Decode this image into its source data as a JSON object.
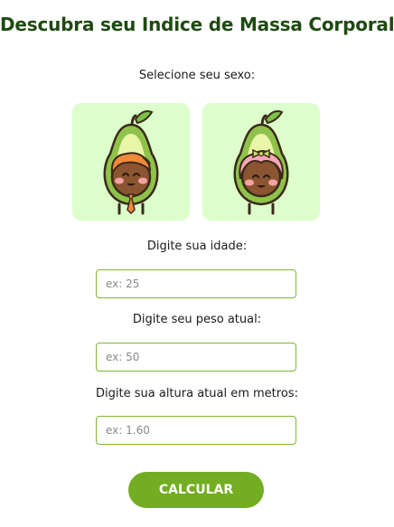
{
  "title": "Descubra seu Indice de Massa Corporal",
  "sex_selection": {
    "label": "Selecione seu sexo:",
    "options": [
      {
        "name": "male-avocado",
        "icon": "male-avocado-icon"
      },
      {
        "name": "female-avocado",
        "icon": "female-avocado-icon"
      }
    ]
  },
  "age": {
    "label": "Digite sua idade:",
    "placeholder": "ex: 25",
    "value": ""
  },
  "weight": {
    "label": "Digite seu peso atual:",
    "placeholder": "ex: 50",
    "value": ""
  },
  "height": {
    "label": "Digite sua altura atual em metros:",
    "placeholder": "ex: 1.60",
    "value": ""
  },
  "calculate_button": {
    "label": "CALCULAR"
  },
  "colors": {
    "title": "#1f4a12",
    "card_background": "#dcffcc",
    "accent": "#73ad21",
    "input_border": "#7cb82f"
  }
}
